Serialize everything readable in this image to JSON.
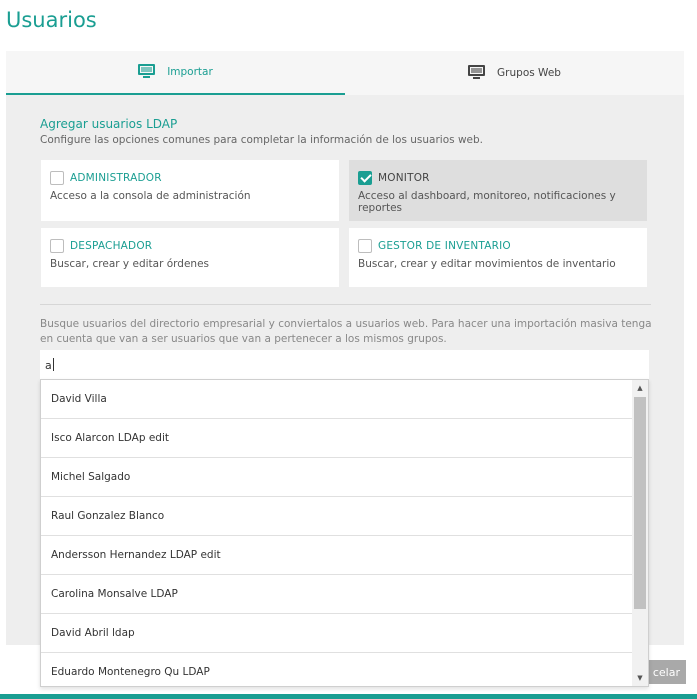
{
  "page": {
    "title": "Usuarios"
  },
  "tabs": [
    {
      "label": "Importar",
      "icon": "monitor-icon",
      "active": true
    },
    {
      "label": "Grupos Web",
      "icon": "monitor-icon",
      "active": false
    }
  ],
  "section": {
    "title": "Agregar usuarios LDAP",
    "description": "Configure las opciones comunes para completar la información de los usuarios web."
  },
  "roles": [
    {
      "name": "ADMINISTRADOR",
      "description": "Acceso a la consola de administración",
      "checked": false
    },
    {
      "name": "MONITOR",
      "description": "Acceso al dashboard, monitoreo, notificaciones y reportes",
      "checked": true
    },
    {
      "name": "DESPACHADOR",
      "description": "Buscar, crear y editar órdenes",
      "checked": false
    },
    {
      "name": "GESTOR DE INVENTARIO",
      "description": "Buscar, crear y editar movimientos de inventario",
      "checked": false
    }
  ],
  "search": {
    "help": "Busque usuarios del directorio empresarial y conviertalos a usuarios web. Para hacer una importación masiva tenga en cuenta que van a ser usuarios que van a pertenecer a los mismos grupos.",
    "value": "a"
  },
  "results": [
    "David Villa",
    "Isco Alarcon LDAp edit",
    "Michel Salgado",
    "Raul Gonzalez Blanco",
    "Andersson Hernandez LDAP edit",
    "Carolina Monsalve LDAP",
    "David Abril ldap",
    "Eduardo Montenegro Qu LDAP"
  ],
  "footer": {
    "cancel_label": "celar"
  },
  "colors": {
    "accent": "#1a9e92",
    "selected_card": "#dedede",
    "panel": "#eeeeee"
  }
}
